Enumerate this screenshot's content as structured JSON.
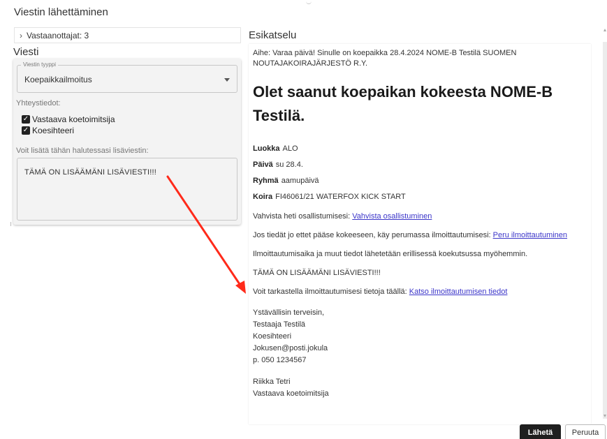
{
  "dialog": {
    "title": "Viestin lähettäminen"
  },
  "recipients": {
    "label": "Vastaanottajat: 3"
  },
  "message": {
    "section_label": "Viesti",
    "type_legend": "Viestin tyyppi",
    "type_value": "Koepaikkailmoitus",
    "contact_label": "Yhteystiedot:",
    "contacts": [
      {
        "label": "Vastaava koetoimitsija",
        "checked": true
      },
      {
        "label": "Koesihteeri",
        "checked": true
      }
    ],
    "extra_label": "Voit lisätä tähän halutessasi lisäviestin:",
    "extra_text": "TÄMÄ ON LISÄÄMÄNI LISÄVIESTI!!!"
  },
  "preview": {
    "label": "Esikatselu",
    "subject": "Aihe: Varaa päivä! Sinulle on koepaikka 28.4.2024 NOME-B Testilä SUOMEN NOUTAJAKOIRAJÄRJESTÖ R.Y.",
    "headline": "Olet saanut koepaikan kokeesta NOME-B Testilä.",
    "info": [
      {
        "key": "Luokka",
        "value": "ALO"
      },
      {
        "key": "Päivä",
        "value": "su 28.4."
      },
      {
        "key": "Ryhmä",
        "value": "aamupäivä"
      },
      {
        "key": "Koira",
        "value": "FI46061/21 WATERFOX KICK START"
      }
    ],
    "confirm_text": "Vahvista heti osallistumisesi:",
    "confirm_link": "Vahvista osallistuminen",
    "cancel_text": "Jos tiedät jo ettet pääse kokeeseen, käy perumassa ilmoittautumisesi:",
    "cancel_link": "Peru ilmoittautuminen",
    "info_text": "Ilmoittautumisaika ja muut tiedot lähetetään erillisessä koekutsussa myöhemmin.",
    "extra_text": "TÄMÄ ON LISÄÄMÄNI LISÄVIESTI!!!",
    "view_text": "Voit tarkastella ilmoittautumisesi tietoja täällä:",
    "view_link": "Katso ilmoittautumisen tiedot",
    "signature": {
      "greeting": "Ystävällisin terveisin,",
      "name": "Testaaja Testilä",
      "role": "Koesihteeri",
      "email": "Jokusen@posti.jokula",
      "phone": "p. 050 1234567"
    },
    "signature2": {
      "name": "Riikka Tetri",
      "role": "Vastaava koetoimitsija"
    }
  },
  "actions": {
    "send_label": "Lähetä",
    "cancel_label": "Peruuta"
  },
  "colors": {
    "link": "#3b35c9",
    "annotation_arrow": "#ff2a1a",
    "send_button": "#1f1f1f"
  }
}
